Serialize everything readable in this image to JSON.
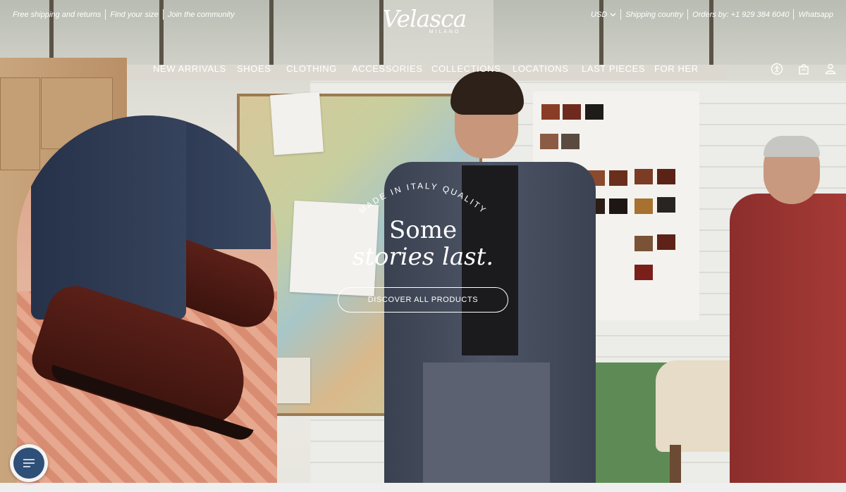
{
  "util_left": {
    "free_shipping": "Free shipping and returns",
    "find_size": "Find your size",
    "community": "Join the community"
  },
  "util_right": {
    "currency": "USD",
    "shipping_country": "Shipping country",
    "orders_by": "Orders by: +1 929 384 6040",
    "whatsapp": "Whatsapp"
  },
  "logo": {
    "name": "Velasca",
    "sub": "MILANO"
  },
  "nav": {
    "items": [
      "NEW ARRIVALS",
      "SHOES",
      "CLOTHING",
      "ACCESSORIES",
      "COLLECTIONS",
      "LOCATIONS",
      "LAST PIECES",
      "FOR HER"
    ]
  },
  "icons": [
    "accessibility-icon",
    "shopping-bag-icon",
    "account-icon",
    "chevron-down-icon",
    "chat-icon"
  ],
  "hero": {
    "arc_text": "MADE IN ITALY QUALITY",
    "headline_line1": "Some",
    "headline_line2": "stories last.",
    "cta": "DISCOVER ALL PRODUCTS"
  },
  "colors": {
    "chat_button": "#2e4f77",
    "text": "#ffffff"
  }
}
